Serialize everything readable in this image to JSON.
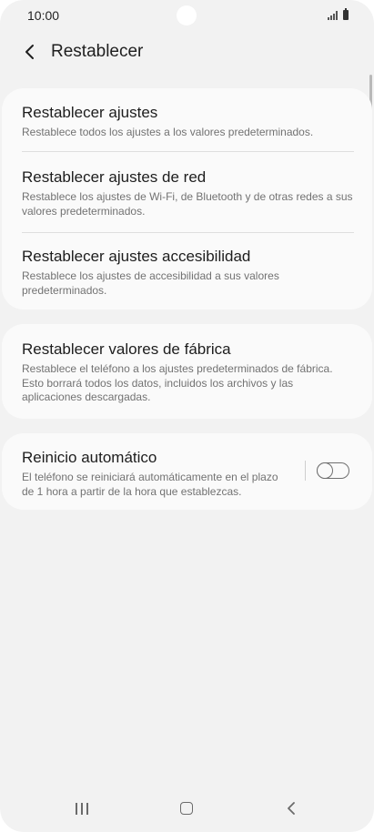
{
  "status_bar": {
    "time": "10:00",
    "icons": [
      "signal-icon",
      "battery-icon"
    ]
  },
  "header": {
    "title": "Restablecer",
    "back_icon": "chevron-left-icon"
  },
  "sections": {
    "reset_settings": {
      "title": "Restablecer ajustes",
      "description": "Restablece todos los ajustes a los valores predeterminados."
    },
    "reset_network": {
      "title": "Restablecer ajustes de red",
      "description": "Restablece los ajustes de Wi-Fi, de Bluetooth y de otras redes a sus valores predeterminados."
    },
    "reset_accessibility": {
      "title": "Restablecer ajustes accesibilidad",
      "description": "Restablece los ajustes de accesibilidad a sus valores predeterminados."
    },
    "factory_reset": {
      "title": "Restablecer valores de fábrica",
      "description": "Restablece el teléfono a los ajustes predeterminados de fábrica. Esto borrará todos los datos, incluidos los archivos y las aplicaciones descargadas."
    },
    "auto_restart": {
      "title": "Reinicio automático",
      "description": "El teléfono se reiniciará automáticamente en el plazo de 1 hora a partir de la hora que establezcas.",
      "toggle_on": false
    }
  },
  "nav_bar": {
    "buttons": [
      "recent-apps-icon",
      "home-icon",
      "back-icon"
    ]
  },
  "colors": {
    "background": "#f2f2f2",
    "card": "#fafafa",
    "title_text": "#1d1d1d",
    "secondary_text": "#727272"
  }
}
